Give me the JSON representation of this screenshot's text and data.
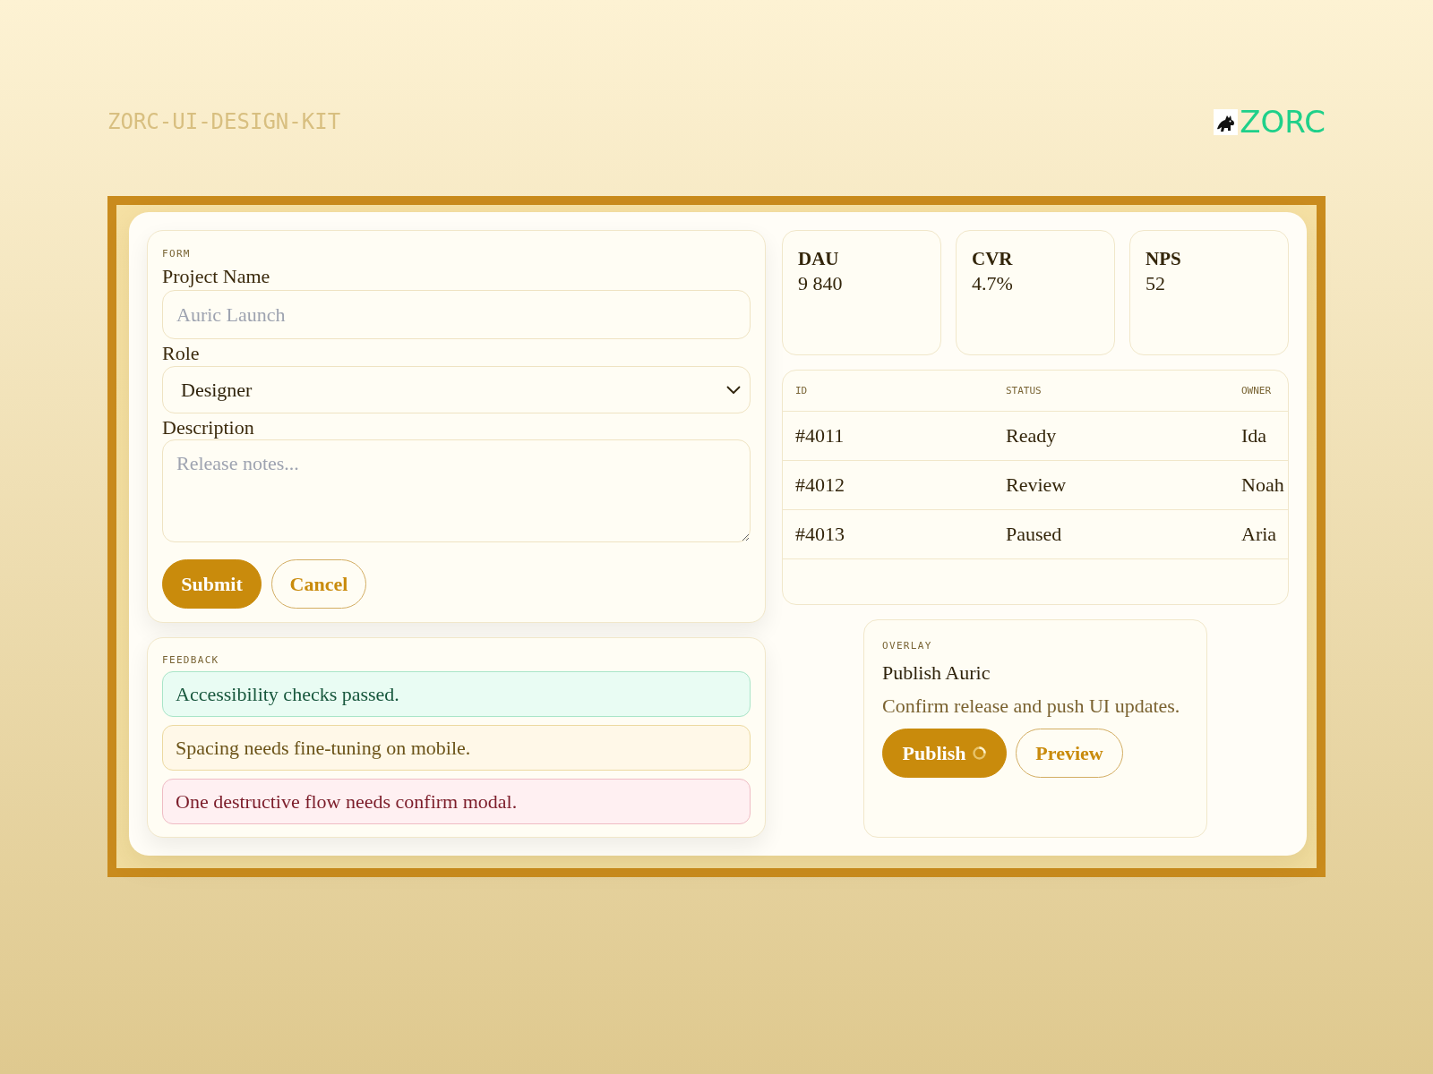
{
  "header": {
    "title": "ZORC-UI-DESIGN-KIT",
    "logo_text": "ZORC"
  },
  "form": {
    "section_label": "FORM",
    "fields": [
      {
        "kind": "text",
        "label": "Project Name",
        "placeholder": "Auric Launch"
      },
      {
        "kind": "select",
        "label": "Role",
        "value": "Designer"
      },
      {
        "kind": "textarea",
        "label": "Description",
        "placeholder": "Release notes..."
      }
    ],
    "buttons": [
      {
        "kind": "primary",
        "label": "Submit"
      },
      {
        "kind": "secondary",
        "label": "Cancel"
      }
    ]
  },
  "feedback": {
    "section_label": "FEEDBACK",
    "alerts": [
      {
        "kind": "success",
        "text": "Accessibility checks passed."
      },
      {
        "kind": "warning",
        "text": "Spacing needs fine-tuning on mobile."
      },
      {
        "kind": "error",
        "text": "One destructive flow needs confirm modal."
      }
    ]
  },
  "stats": [
    {
      "label": "DAU",
      "value": "9 840"
    },
    {
      "label": "CVR",
      "value": "4.7%"
    },
    {
      "label": "NPS",
      "value": "52"
    }
  ],
  "table": {
    "columns": [
      "ID",
      "STATUS",
      "OWNER"
    ],
    "rows": [
      [
        "#4011",
        "Ready",
        "Ida"
      ],
      [
        "#4012",
        "Review",
        "Noah"
      ],
      [
        "#4013",
        "Paused",
        "Aria"
      ]
    ]
  },
  "overlay": {
    "section_label": "OVERLAY",
    "title": "Publish Auric",
    "message": "Confirm release and push UI updates.",
    "buttons": [
      {
        "kind": "primary",
        "label": "Publish",
        "loading": true
      },
      {
        "kind": "secondary",
        "label": "Preview",
        "loading": false
      }
    ]
  }
}
